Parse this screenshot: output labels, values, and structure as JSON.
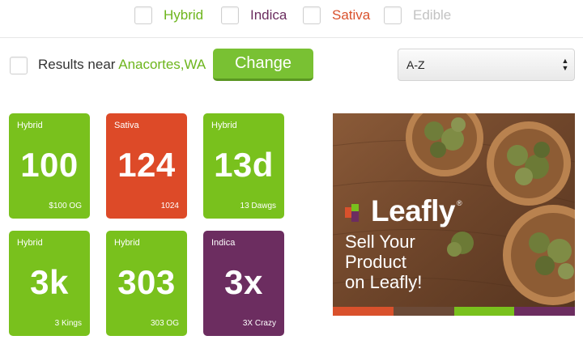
{
  "filters": [
    {
      "label": "Hybrid",
      "color": "#6db51c"
    },
    {
      "label": "Indica",
      "color": "#6b2d5f"
    },
    {
      "label": "Sativa",
      "color": "#d9512c"
    },
    {
      "label": "Edible",
      "color": "#c2c2c2"
    }
  ],
  "location": {
    "prefix": "Results near ",
    "city": "Anacortes,WA",
    "change_label": "Change"
  },
  "sort": {
    "selected": "A-Z",
    "arrow_up": "▲",
    "arrow_down": "▼"
  },
  "strains": [
    {
      "type": "Hybrid",
      "code": "100",
      "name": "$100 OG",
      "color": "#79c11d"
    },
    {
      "type": "Sativa",
      "code": "124",
      "name": "1024",
      "color": "#dd4a28"
    },
    {
      "type": "Hybrid",
      "code": "13d",
      "name": "13 Dawgs",
      "color": "#79c11d"
    },
    {
      "type": "Hybrid",
      "code": "3k",
      "name": "3 Kings",
      "color": "#79c11d"
    },
    {
      "type": "Hybrid",
      "code": "303",
      "name": "303 OG",
      "color": "#79c11d"
    },
    {
      "type": "Indica",
      "code": "3x",
      "name": "3X Crazy",
      "color": "#6c2d60"
    }
  ],
  "ad": {
    "brand": "Leafly",
    "registered": "®",
    "tagline_1": "Sell Your",
    "tagline_2": "Product",
    "tagline_3": "on Leafly!",
    "stripe_colors": [
      "#d9512c",
      "#6b4a37",
      "#79c11d",
      "#6c2d60"
    ]
  }
}
